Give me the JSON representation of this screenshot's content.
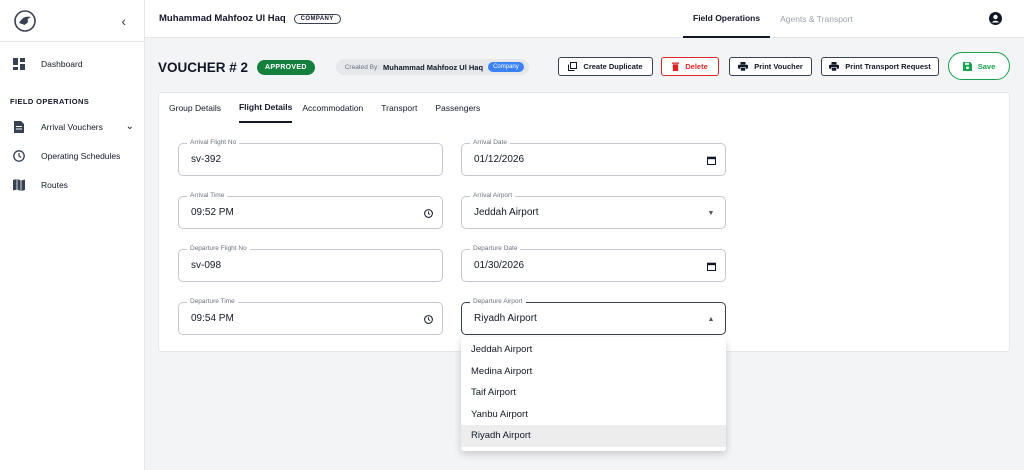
{
  "sidebar": {
    "items": [
      {
        "label": "Dashboard",
        "icon": "dashboard-icon"
      },
      {
        "label": "Arrival Vouchers",
        "icon": "document-icon"
      },
      {
        "label": "Operating Schedules",
        "icon": "clock-icon"
      },
      {
        "label": "Routes",
        "icon": "map-icon"
      }
    ],
    "section": "FIELD OPERATIONS"
  },
  "topbar": {
    "user_name": "Muhammad Mahfooz Ul Haq",
    "user_role": "COMPANY",
    "tabs": [
      "Field Operations",
      "Agents & Transport"
    ]
  },
  "voucher": {
    "title": "VOUCHER # 2",
    "status": "APPROVED",
    "created_by_label": "Created By:",
    "created_by": "Muhammad Mahfooz Ul Haq",
    "created_by_role": "Company",
    "buttons": {
      "duplicate": "Create Duplicate",
      "delete": "Delete",
      "print_voucher": "Print Voucher",
      "print_transport": "Print Transport Request",
      "save": "Save"
    }
  },
  "form_tabs": [
    "Group Details",
    "Flight Details",
    "Accommodation",
    "Transport",
    "Passengers"
  ],
  "fields": {
    "arrival_flight_no": {
      "label": "Arrival Flight No",
      "value": "sv-392"
    },
    "arrival_date": {
      "label": "Arrival Date",
      "value": "01/12/2026"
    },
    "arrival_time": {
      "label": "Arrival Time",
      "value": "09:52 PM"
    },
    "arrival_airport": {
      "label": "Arrival Airport",
      "value": "Jeddah Airport"
    },
    "departure_flight_no": {
      "label": "Departure Flight No",
      "value": "sv-098"
    },
    "departure_date": {
      "label": "Departure Date",
      "value": "01/30/2026"
    },
    "departure_time": {
      "label": "Departure Time",
      "value": "09:54 PM"
    },
    "departure_airport": {
      "label": "Departure Airport",
      "value": "Riyadh Airport"
    }
  },
  "dropdown_options": [
    "Jeddah Airport",
    "Medina Airport",
    "Taif Airport",
    "Yanbu Airport",
    "Riyadh Airport"
  ],
  "colors": {
    "approved": "#15803d",
    "delete": "#dc2626",
    "save": "#16a34a",
    "company_chip": "#3b82f6"
  }
}
